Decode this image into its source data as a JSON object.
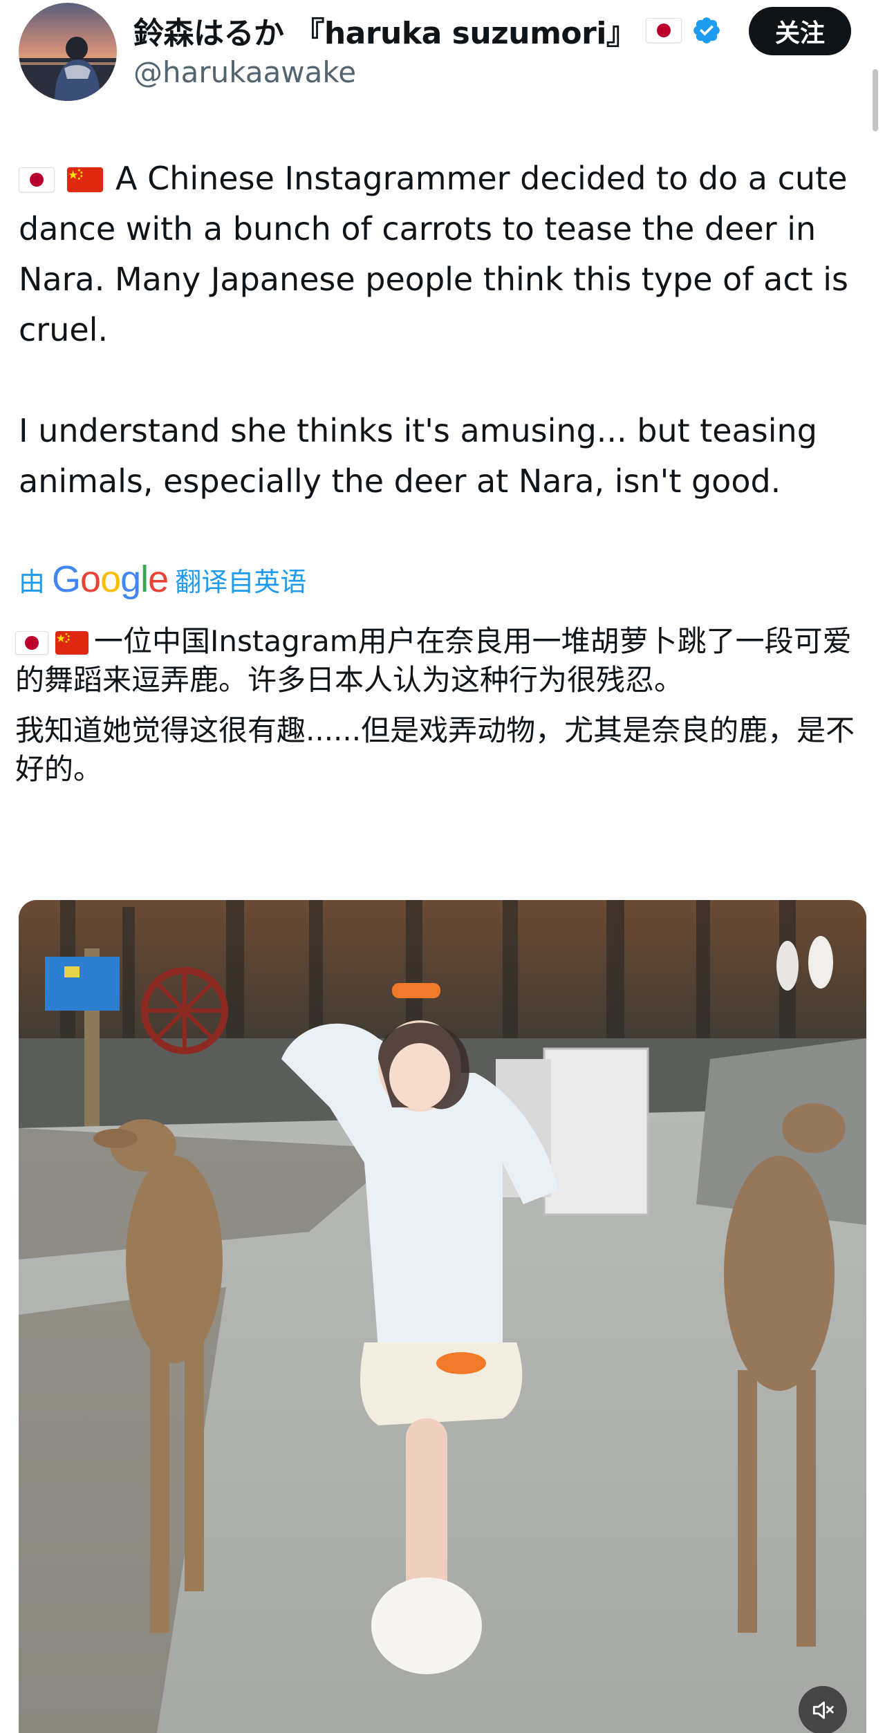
{
  "author": {
    "display_name": "鈴森はるか 『haruka suzumori』",
    "handle": "@harukaawake",
    "flag_icon": "japan-flag-icon",
    "verified_icon": "verified-badge-icon",
    "verified_color": "#1d9bf0"
  },
  "actions": {
    "follow_label": "关注"
  },
  "post": {
    "paragraph_1": "A Chinese Instagrammer decided to do a cute dance with a bunch of carrots to tease the deer in Nara. Many Japanese people think this type of act is cruel.",
    "paragraph_2": "I understand she thinks it's amusing... but teasing animals, especially the deer at Nara, isn't good.",
    "flags": [
      "japan-flag-icon",
      "china-flag-icon"
    ]
  },
  "translation_note": {
    "prefix": "由",
    "provider": "Google",
    "suffix": "翻译自英语",
    "link_color": "#1d9bf0"
  },
  "translation": {
    "paragraph_1": "一位中国Instagram用户在奈良用一堆胡萝卜跳了一段可爱的舞蹈来逗弄鹿。许多日本人认为这种行为很残忍。",
    "paragraph_2": "我知道她觉得这很有趣......但是戏弄动物，尤其是奈良的鹿，是不好的。"
  },
  "media": {
    "type": "video",
    "mute_icon": "speaker-muted-icon"
  }
}
